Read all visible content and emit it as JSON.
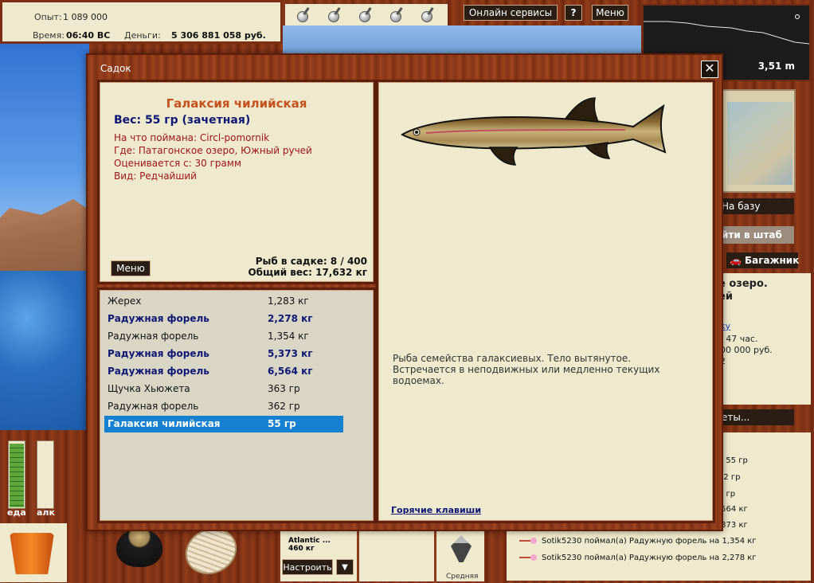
{
  "hud": {
    "exp_label": "Опыт:",
    "exp_value": "1 089 000",
    "time_label": "Время:",
    "time_value": "06:40 ВС",
    "money_label": "Деньги:",
    "money_value": "5 306 881 058 руб.",
    "online_services": "Онлайн сервисы",
    "help": "?",
    "menu": "Меню",
    "distance": "3,51 m"
  },
  "side": {
    "base_btn": "На базу",
    "hq_btn": "йти в штаб",
    "trunk_btn": "Багажник",
    "place_line1": "е озеро.",
    "place_line2": "ей",
    "link": "ку",
    "line_time": ": 47 час.",
    "line_money": "00 000 руб.",
    "line_num": "2",
    "ets_btn": "еты..."
  },
  "chat": [
    {
      "text": "а 55 гр"
    },
    {
      "text": "62 гр"
    },
    {
      "text": "3 гр"
    },
    {
      "text": ",564 кг"
    },
    {
      "text": ",373 кг"
    },
    {
      "text": "Sotik5230 поймал(а) Радужную форель на 1,354 кг"
    },
    {
      "text": "Sotik5230 поймал(а) Радужную форель на 2,278 кг"
    }
  ],
  "gauges": {
    "food_label": "еда",
    "alc_label": "алк",
    "food_level": 0.98,
    "alc_level": 0.0
  },
  "tackle": {
    "name": "Atlantic ...",
    "weight": "460 кг",
    "setup_btn": "Настроить",
    "arrow": "▼",
    "lure_caption": "Средняя"
  },
  "modal": {
    "title": "Садок",
    "close": "✕",
    "fish_name": "Галаксия чилийская",
    "fish_weight": "Вес: 55 гр (зачетная)",
    "caught_on": "На что поймана: Circl-pomornik",
    "where": "Где: Патагонское озеро, Южный ручей",
    "valued_from": "Оценивается с: 30 грамм",
    "kind": "Вид: Редчайший",
    "menu_btn": "Меню",
    "fish_count": "Рыб в садке: 8 / 400",
    "total_weight": "Общий вес: 17,632 кг",
    "description": "Рыба семейства галаксиевых. Тело вытянутое. Встречается в неподвижных или медленно текущих водоемах.",
    "hotkeys": "Горячие клавиши",
    "fish_list": [
      {
        "name": "Жерех",
        "weight": "1,283 кг",
        "style": "normal"
      },
      {
        "name": "Радужная форель",
        "weight": "2,278 кг",
        "style": "bold"
      },
      {
        "name": "Радужная форель",
        "weight": "1,354 кг",
        "style": "normal"
      },
      {
        "name": "Радужная форель",
        "weight": "5,373 кг",
        "style": "bold"
      },
      {
        "name": "Радужная форель",
        "weight": "6,564 кг",
        "style": "bold"
      },
      {
        "name": "Щучка Хьюжета",
        "weight": "363 гр",
        "style": "normal"
      },
      {
        "name": "Радужная форель",
        "weight": "362 гр",
        "style": "normal"
      },
      {
        "name": "Галаксия чилийская",
        "weight": "55 гр",
        "style": "selected"
      }
    ]
  }
}
